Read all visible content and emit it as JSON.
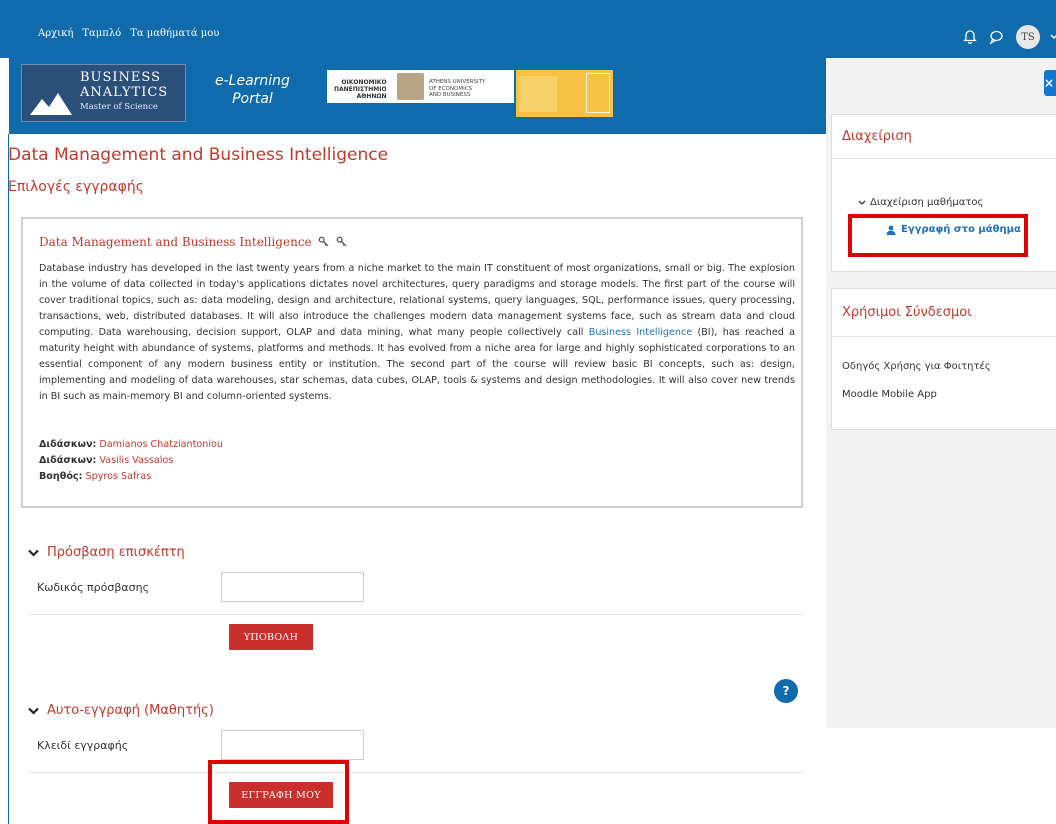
{
  "topbar": {
    "nav": [
      "Αρχική",
      "Ταμπλό",
      "Τα μαθήματά μου"
    ],
    "avatar_initials": "TS"
  },
  "banner": {
    "logo_line1": "BUSINESS",
    "logo_line2": "ANALYTICS",
    "logo_line3": "Master of Science",
    "portal_line1": "e-Learning",
    "portal_line2": "Portal",
    "aueb_gr_line1": "ΟΙΚΟΝΟΜΙΚΟ",
    "aueb_gr_line2": "ΠΑΝΕΠΙΣΤΗΜΙΟ",
    "aueb_gr_line3": "ΑΘΗΝΩΝ",
    "aueb_en_line1": "ATHENS UNIVERSITY",
    "aueb_en_line2": "OF ECONOMICS",
    "aueb_en_line3": "AND BUSINESS"
  },
  "page": {
    "title": "Data Management and Business Intelligence",
    "subtitle": "Επιλογές εγγραφής"
  },
  "course": {
    "name": "Data Management and Business Intelligence",
    "summary_part1": "Database industry has developed in the last twenty years from a niche market to the main IT constituent of most organizations, small or big. The explosion in the volume of data collected in today's applications dictates novel architectures, query paradigms and storage models. The first part of the course will cover traditional topics, such as: data modeling, design and architecture, relational systems, query languages, SQL, performance issues, query processing, transactions, web, distributed databases. It will also introduce the challenges modern data management systems face, such as stream data and cloud computing. Data warehousing, decision support, OLAP and data mining, what many people collectively call ",
    "summary_link": "Business Intelligence",
    "summary_part2": " (BI), has reached a maturity height with abundance of systems, platforms and methods. It has evolved from a niche area for large and highly sophisticated corporations to an essential component of any modern business entity or institution. The second part of the course will review basic BI concepts, such as: design, implementing and modeling of data warehouses, star schemas, data cubes, OLAP, tools & systems and design methodologies. It will also cover new trends in BI such as main-memory BI and column-oriented systems.",
    "staff": [
      {
        "role": "Διδάσκων:",
        "name": "Damianos Chatziantoniou"
      },
      {
        "role": "Διδάσκων:",
        "name": "Vasilis Vassalos"
      },
      {
        "role": "Βοηθός:",
        "name": "Spyros Safras"
      }
    ]
  },
  "guest_access": {
    "heading": "Πρόσβαση επισκέπτη",
    "password_label": "Κωδικός πρόσβασης",
    "password_value": "",
    "submit_label": "ΥΠΟΒΟΛΗ"
  },
  "self_enrol": {
    "heading": "Αυτο-εγγραφή (Μαθητής)",
    "key_label": "Κλειδί εγγραφής",
    "key_value": "",
    "submit_label": "ΕΓΓΡΑΦΗ ΜΟΥ"
  },
  "drawer": {
    "close_label": "×",
    "admin": {
      "heading": "Διαχείριση",
      "course_admin_label": "Διαχείριση μαθήματος",
      "enrol_link": "Εγγραφή στο μάθημα"
    },
    "links": {
      "heading": "Χρήσιμοι Σύνδεσμοι",
      "items": [
        "Οδηγός Χρήσης για Φοιτητές",
        "Moodle Mobile App"
      ]
    }
  },
  "colors": {
    "navbar": "#0f6bab",
    "heading_red": "#c0392b",
    "button_red": "#c9302c",
    "highlight_box": "#e00000",
    "link_blue": "#1e73b8"
  }
}
